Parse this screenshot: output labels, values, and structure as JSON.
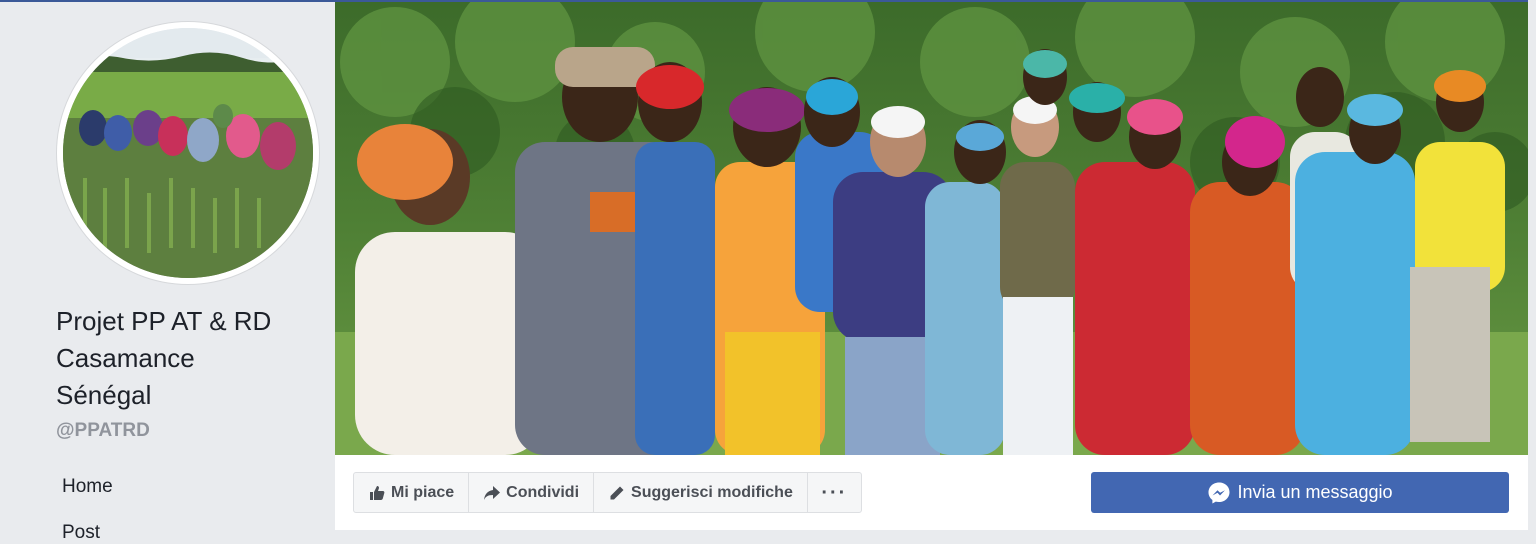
{
  "page": {
    "name_lines": [
      "Projet PP AT & RD",
      "Casamance",
      "Sénégal"
    ],
    "handle": "@PPATRD"
  },
  "nav": {
    "items": [
      {
        "label": "Home"
      },
      {
        "label": "Post"
      }
    ]
  },
  "actions": {
    "like_label": "Mi piace",
    "share_label": "Condividi",
    "suggest_label": "Suggerisci modifiche",
    "more_label": "···",
    "message_label": "Invia un messaggio"
  },
  "colors": {
    "page_bg": "#e9ebee",
    "brand_blue": "#4267b2",
    "text_primary": "#1d2129",
    "text_secondary": "#90949c"
  },
  "icons": {
    "like": "thumbs-up-icon",
    "share": "share-arrow-icon",
    "suggest": "pencil-icon",
    "message": "messenger-icon"
  }
}
